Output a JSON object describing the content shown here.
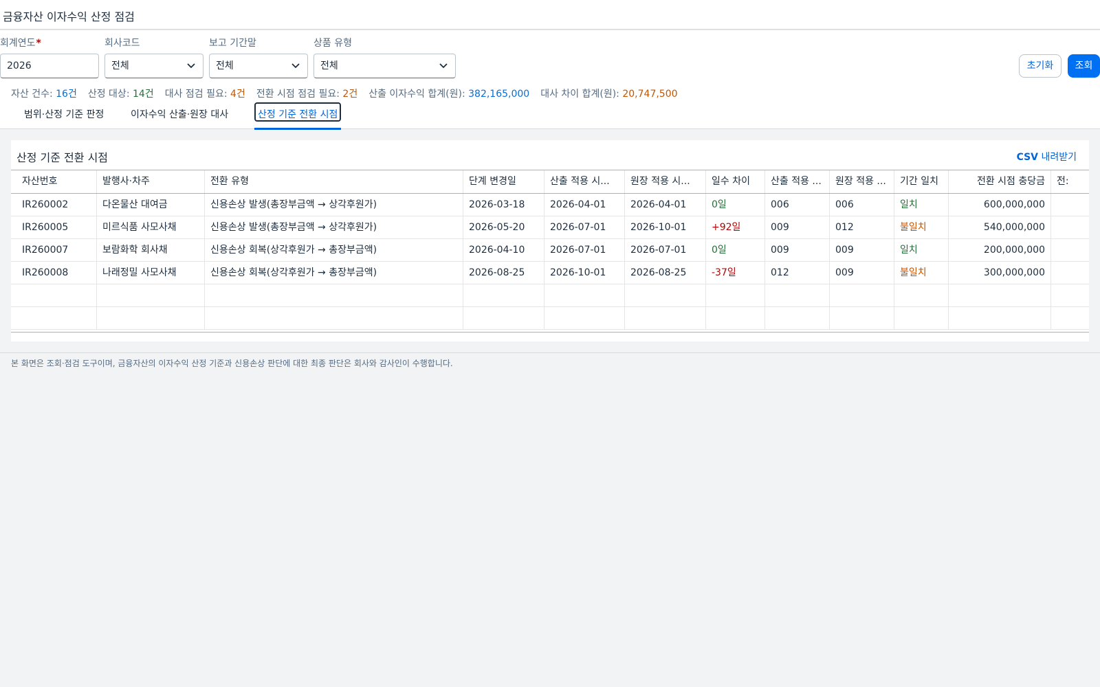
{
  "app": {
    "title": "금융자산 이자수익 산정 점검"
  },
  "filters": {
    "fiscal_year": {
      "label": "회계연도",
      "required_mark": "*",
      "value": "2026"
    },
    "company_code": {
      "label": "회사코드",
      "value": "전체"
    },
    "period_end": {
      "label": "보고 기간말",
      "value": "전체"
    },
    "product_type": {
      "label": "상품 유형",
      "value": "전체"
    },
    "reset_label": "초기화",
    "search_label": "조회"
  },
  "summary": [
    {
      "label": "자산 건수: ",
      "value": "16건",
      "tone": "blue"
    },
    {
      "label": "산정 대상: ",
      "value": "14건",
      "tone": "green"
    },
    {
      "label": "대사 점검 필요: ",
      "value": "4건",
      "tone": "orange"
    },
    {
      "label": "전환 시점 점검 필요: ",
      "value": "2건",
      "tone": "orange"
    },
    {
      "label": "산출 이자수익 합계(원): ",
      "value": "382,165,000",
      "tone": "blue"
    },
    {
      "label": "대사 차이 합계(원): ",
      "value": "20,747,500",
      "tone": "orange"
    }
  ],
  "tabs": [
    {
      "label": "범위·산정 기준 판정",
      "active": false
    },
    {
      "label": "이자수익 산출·원장 대사",
      "active": false
    },
    {
      "label": "산정 기준 전환 시점",
      "active": true
    }
  ],
  "card": {
    "title": "산정 기준 전환 시점",
    "csv_bold": "CSV",
    "csv_rest": " 내려받기"
  },
  "table": {
    "columns": [
      "자산번호",
      "발행사·차주",
      "전환 유형",
      "단계 변경일",
      "산출 적용 시...",
      "원장 적용 시...",
      "일수 차이",
      "산출 적용 ...",
      "원장 적용 ...",
      "기간 일치",
      "전환 시점 충당금",
      "전:"
    ],
    "rows": [
      [
        "IR260002",
        "다온물산 대여금",
        "신용손상 발생(총장부금액 → 상각후원가)",
        "2026-03-18",
        "2026-04-01",
        "2026-04-01",
        "0일",
        "006",
        "006",
        "일치",
        "600,000,000",
        ""
      ],
      [
        "IR260005",
        "미르식품 사모사채",
        "신용손상 발생(총장부금액 → 상각후원가)",
        "2026-05-20",
        "2026-07-01",
        "2026-10-01",
        "+92일",
        "009",
        "012",
        "불일치",
        "540,000,000",
        ""
      ],
      [
        "IR260007",
        "보람화학 회사채",
        "신용손상 회복(상각후원가 → 총장부금액)",
        "2026-04-10",
        "2026-07-01",
        "2026-07-01",
        "0일",
        "009",
        "009",
        "일치",
        "200,000,000",
        ""
      ],
      [
        "IR260008",
        "나래정밀 사모사채",
        "신용손상 회복(상각후원가 → 총장부금액)",
        "2026-08-25",
        "2026-10-01",
        "2026-08-25",
        "-37일",
        "012",
        "009",
        "불일치",
        "300,000,000",
        ""
      ]
    ],
    "empty_rows": 2
  },
  "footer": {
    "note": "본 화면은 조회·점검 도구이며, 금융자산의 이자수익 산정 기준과 신용손상 판단에 대한 최종 판단은 회사와 감사인이 수행합니다."
  }
}
